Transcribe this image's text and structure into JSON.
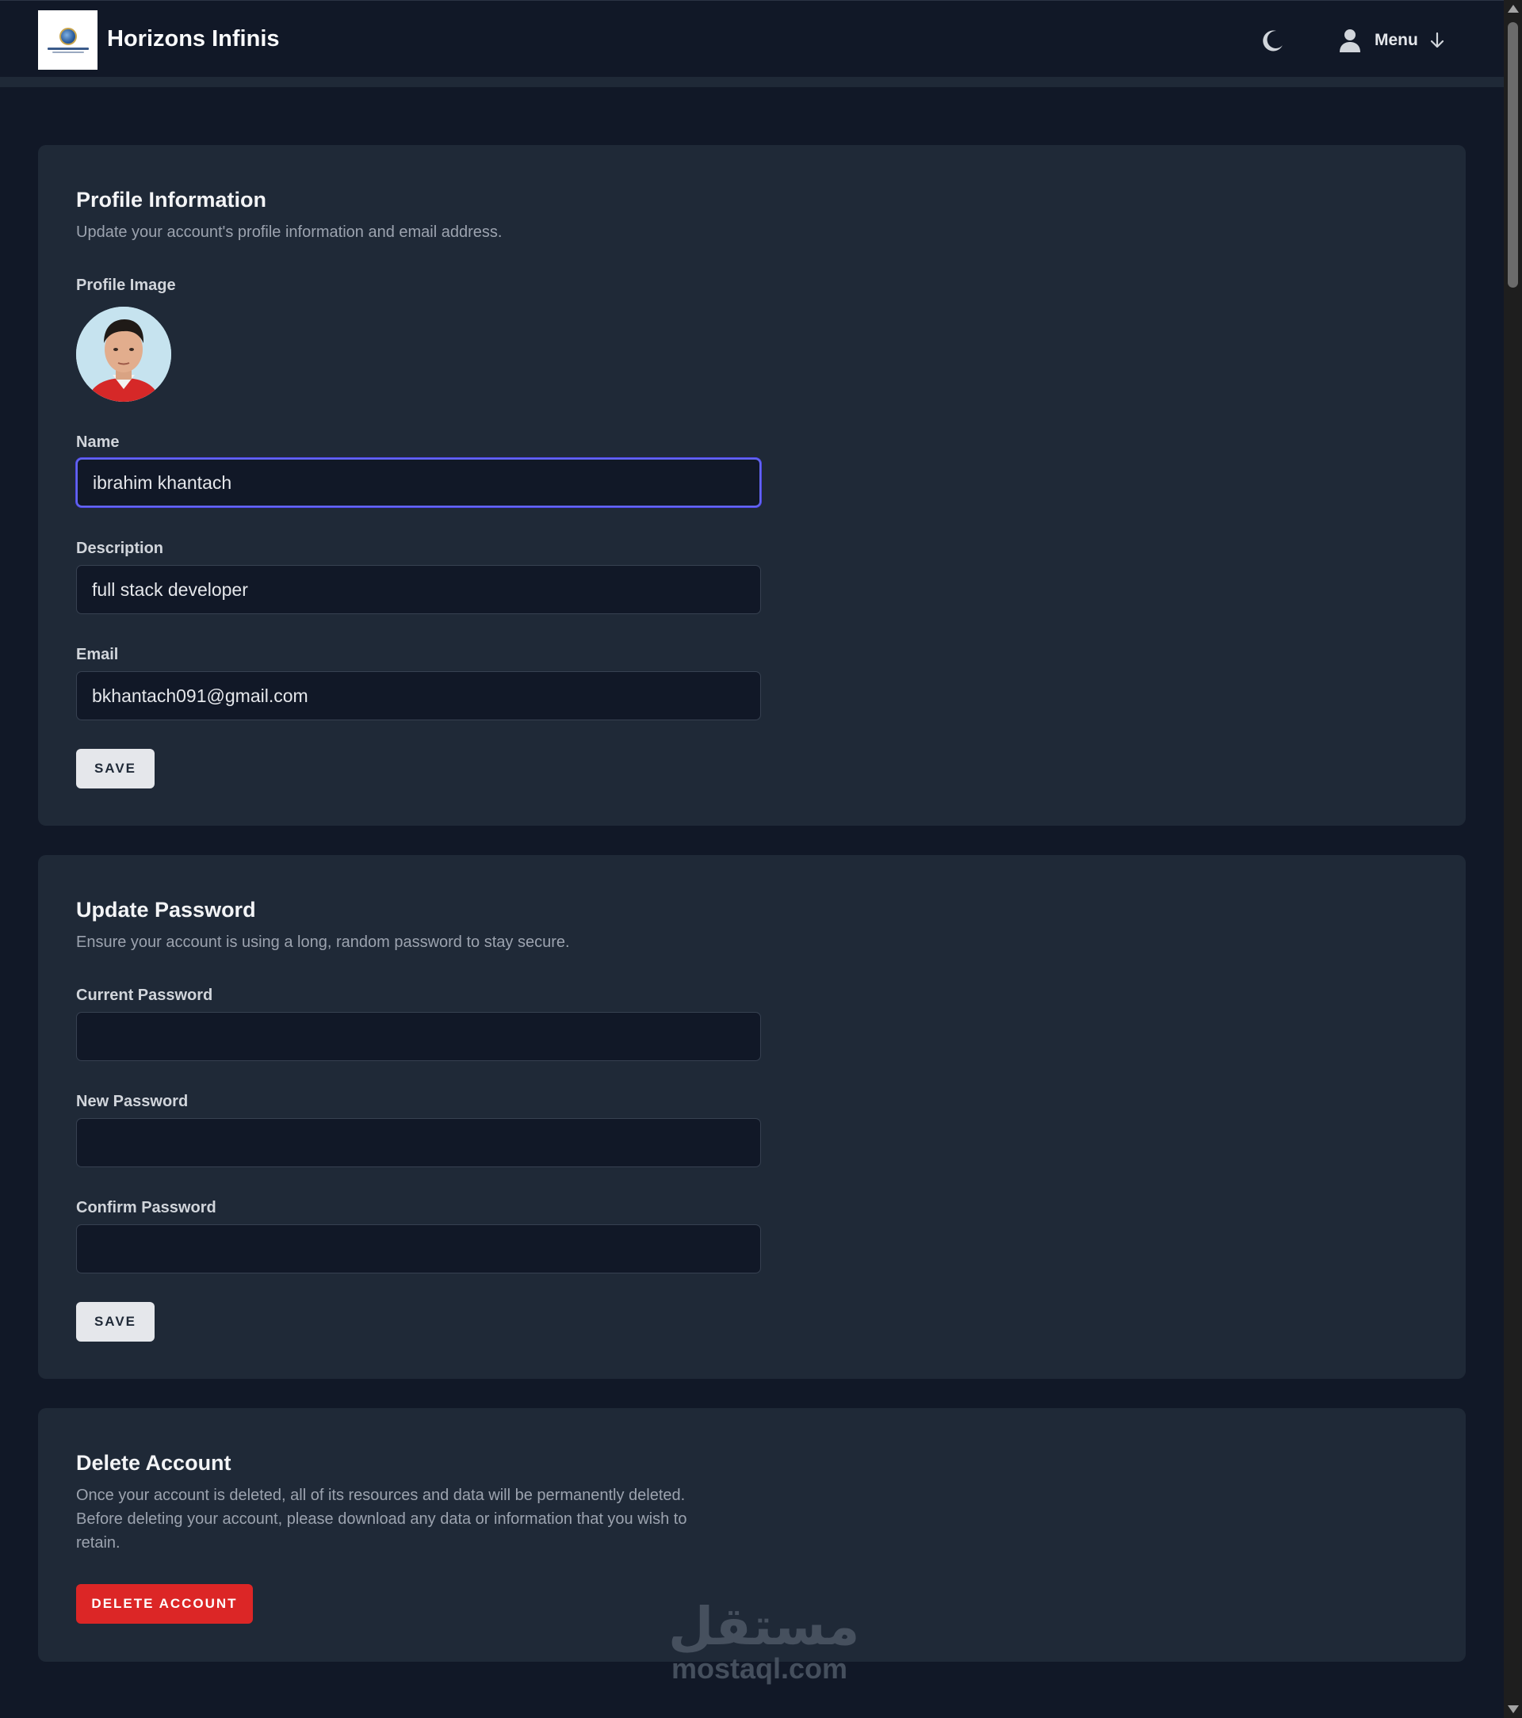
{
  "header": {
    "app_title": "Horizons Infinis",
    "menu_label": "Menu",
    "logo_icon": "horizons-infinis-logo",
    "theme_icon": "moon-icon",
    "user_icon": "user-icon",
    "menu_arrow_icon": "arrow-down-icon"
  },
  "profile": {
    "title": "Profile Information",
    "description": "Update your account's profile information and email address.",
    "image_label": "Profile Image",
    "name_label": "Name",
    "name_value": "ibrahim khantach",
    "description_label": "Description",
    "description_value": "full stack developer",
    "email_label": "Email",
    "email_value": "bkhantach091@gmail.com",
    "save_label": "SAVE"
  },
  "password": {
    "title": "Update Password",
    "description": "Ensure your account is using a long, random password to stay secure.",
    "current_label": "Current Password",
    "current_value": "",
    "new_label": "New Password",
    "new_value": "",
    "confirm_label": "Confirm Password",
    "confirm_value": "",
    "save_label": "SAVE"
  },
  "delete": {
    "title": "Delete Account",
    "description_line1": "Once your account is deleted, all of its resources and data will be permanently deleted.",
    "description_line2": "Before deleting your account, please download any data or information that you wish to",
    "description_line3": "retain.",
    "button_label": "DELETE ACCOUNT"
  },
  "watermark": {
    "arabic": "مستقل",
    "latin": "mostaql.com"
  },
  "colors": {
    "background": "#111827",
    "card": "#1f2937",
    "focus_ring": "#6366f1",
    "danger": "#dc2626"
  }
}
